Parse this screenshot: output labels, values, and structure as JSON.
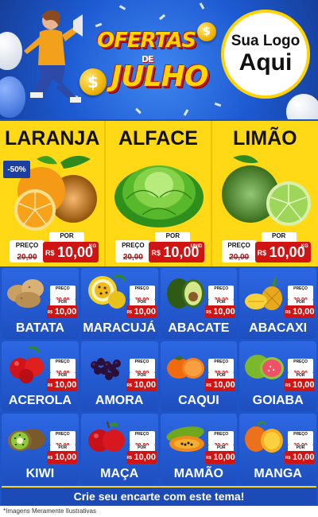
{
  "header": {
    "title_line1": "OFERTAS",
    "title_line2": "DE",
    "title_line3": "JULHO",
    "coin_symbol": "$",
    "logo_line1": "Sua Logo",
    "logo_line2": "Aqui"
  },
  "colors": {
    "yellow": "#ffd916",
    "blue": "#1d55c9",
    "red": "#d01414"
  },
  "featured": [
    {
      "name": "LARANJA",
      "badge": "-50%",
      "old_label": "PREÇO",
      "old_price": "20,00",
      "por": "POR",
      "currency": "R$",
      "new_price": "10,00",
      "unit": "KG"
    },
    {
      "name": "ALFACE",
      "old_label": "PREÇO",
      "old_price": "20,00",
      "por": "POR",
      "currency": "R$",
      "new_price": "10,00",
      "unit": "UNID"
    },
    {
      "name": "LIMÃO",
      "old_label": "PREÇO",
      "old_price": "20,00",
      "por": "POR",
      "currency": "R$",
      "new_price": "10,00",
      "unit": "KG"
    }
  ],
  "products": [
    {
      "name": "BATATA"
    },
    {
      "name": "MARACUJÁ"
    },
    {
      "name": "ABACATE"
    },
    {
      "name": "ABACAXI"
    },
    {
      "name": "ACEROLA"
    },
    {
      "name": "AMORA"
    },
    {
      "name": "CAQUI"
    },
    {
      "name": "GOIABA"
    },
    {
      "name": "KIWI"
    },
    {
      "name": "MAÇA"
    },
    {
      "name": "MAMÃO"
    },
    {
      "name": "MANGA"
    }
  ],
  "price_small": {
    "old_label": "PREÇO",
    "old_price": "20,00",
    "por": "POR",
    "currency": "R$",
    "new_price": "10,00"
  },
  "footer": {
    "cta": "Crie seu encarte com este tema!",
    "disclaimer": "*Imagens Meramente Ilustrativas"
  }
}
